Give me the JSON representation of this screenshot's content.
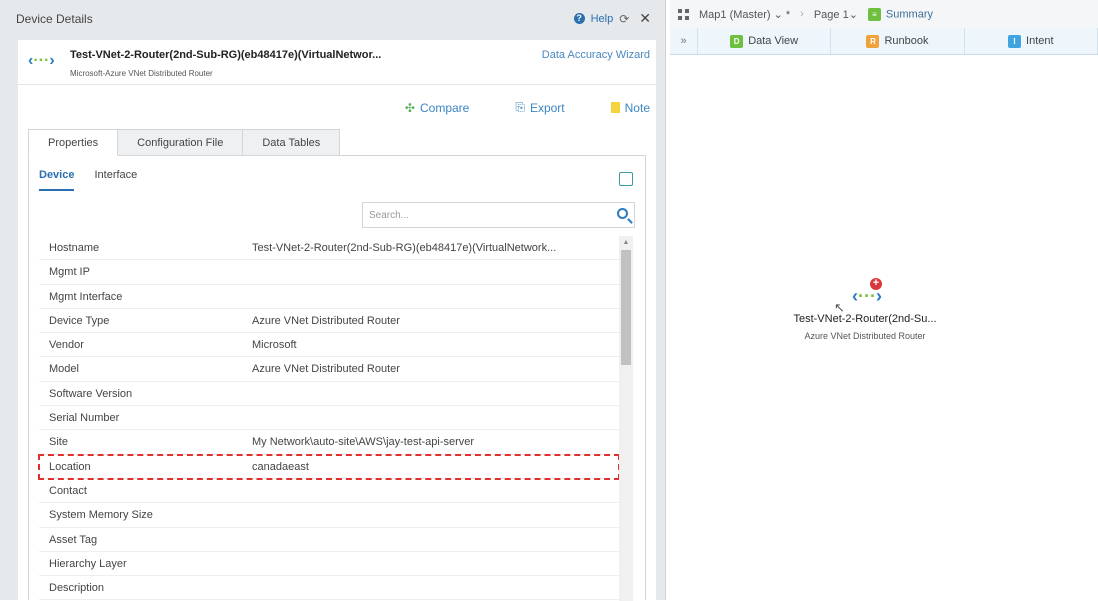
{
  "panel": {
    "title": "Device Details",
    "help": "Help"
  },
  "device": {
    "name": "Test-VNet-2-Router(2nd-Sub-RG)(eb48417e)(VirtualNetwor...",
    "subtitle": "Microsoft-Azure VNet Distributed Router",
    "wizard": "Data Accuracy Wizard"
  },
  "actions": {
    "compare": "Compare",
    "export": "Export",
    "note": "Note"
  },
  "tabs": [
    "Properties",
    "Configuration File",
    "Data Tables"
  ],
  "subtabs": [
    "Device",
    "Interface"
  ],
  "search": {
    "placeholder": "Search..."
  },
  "rows": [
    {
      "k": "Hostname",
      "v": "Test-VNet-2-Router(2nd-Sub-RG)(eb48417e)(VirtualNetwork..."
    },
    {
      "k": "Mgmt IP",
      "v": ""
    },
    {
      "k": "Mgmt Interface",
      "v": ""
    },
    {
      "k": "Device Type",
      "v": "Azure VNet Distributed Router"
    },
    {
      "k": "Vendor",
      "v": "Microsoft"
    },
    {
      "k": "Model",
      "v": "Azure VNet Distributed Router"
    },
    {
      "k": "Software Version",
      "v": ""
    },
    {
      "k": "Serial Number",
      "v": ""
    },
    {
      "k": "Site",
      "v": "My Network\\auto-site\\AWS\\jay-test-api-server"
    },
    {
      "k": "Location",
      "v": "canadaeast"
    },
    {
      "k": "Contact",
      "v": ""
    },
    {
      "k": "System Memory Size",
      "v": ""
    },
    {
      "k": "Asset Tag",
      "v": ""
    },
    {
      "k": "Hierarchy Layer",
      "v": ""
    },
    {
      "k": "Description",
      "v": ""
    }
  ],
  "map": {
    "map": "Map1 (Master)",
    "modified": "*",
    "page": "Page 1",
    "summary": "Summary",
    "tabs": [
      {
        "letter": "D",
        "label": "Data View",
        "color": "#6cbf3f"
      },
      {
        "letter": "R",
        "label": "Runbook",
        "color": "#f0a33a"
      },
      {
        "letter": "I",
        "label": "Intent",
        "color": "#3fa4e0"
      }
    ],
    "node": {
      "label": "Test-VNet-2-Router(2nd-Su...",
      "sub": "Azure VNet Distributed Router"
    }
  }
}
